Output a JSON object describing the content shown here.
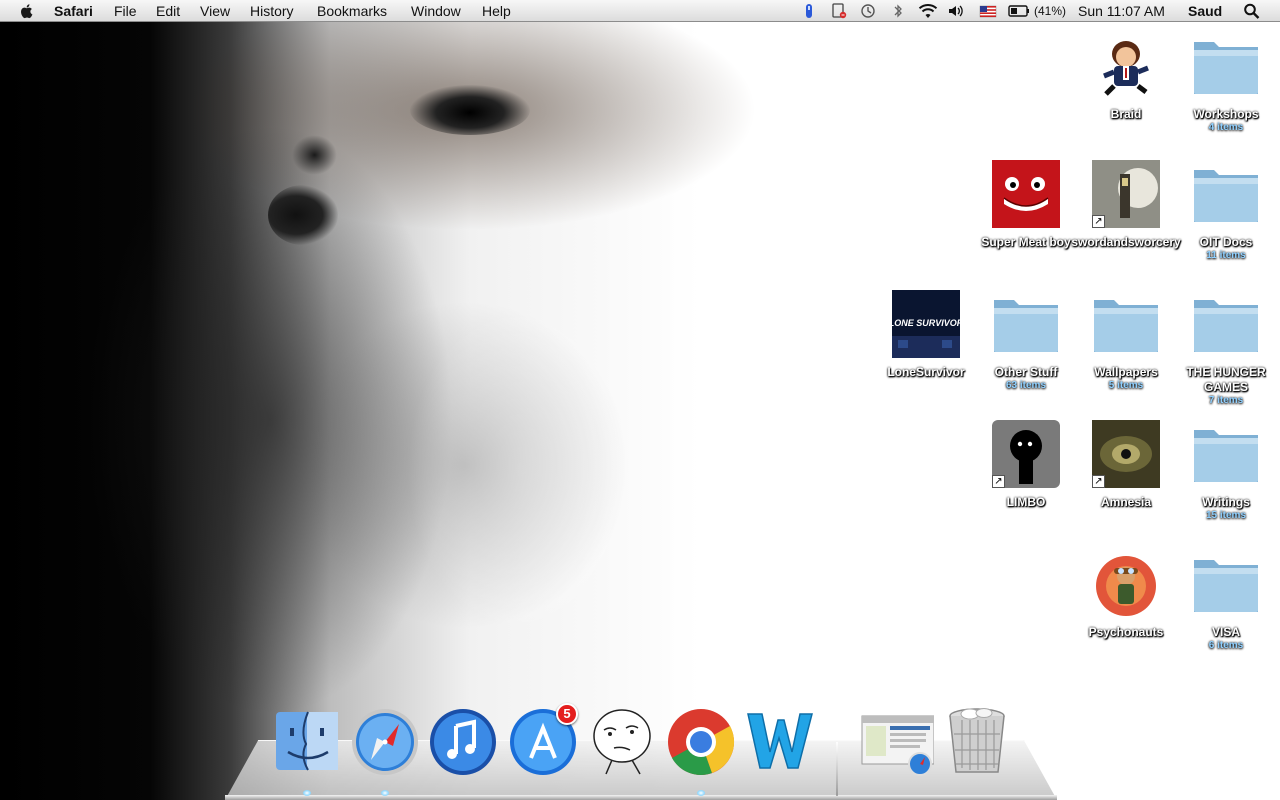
{
  "menubar": {
    "app_name": "Safari",
    "menus": [
      "File",
      "Edit",
      "View",
      "History",
      "Bookmarks",
      "Window",
      "Help"
    ],
    "battery_percent": "(41%)",
    "clock": "Sun 11:07 AM",
    "user": "Saud"
  },
  "desktop_icons": [
    {
      "label": "Braid",
      "sub": "",
      "kind": "game-art"
    },
    {
      "label": "Workshops",
      "sub": "4 items",
      "kind": "folder"
    },
    {
      "label": "Super Meat boy",
      "sub": "",
      "kind": "game-art"
    },
    {
      "label": "swordandsworcery",
      "sub": "",
      "kind": "game-art-alias"
    },
    {
      "label": "OIT Docs",
      "sub": "11 items",
      "kind": "folder"
    },
    {
      "label": "LoneSurvivor",
      "sub": "",
      "kind": "game-art",
      "art_text": "LONE SURVIVOR"
    },
    {
      "label": "Other Stuff",
      "sub": "63 items",
      "kind": "folder"
    },
    {
      "label": "Wallpapers",
      "sub": "5 items",
      "kind": "folder"
    },
    {
      "label": "THE HUNGER GAMES",
      "sub": "7 items",
      "kind": "folder"
    },
    {
      "label": "LIMBO",
      "sub": "",
      "kind": "game-art-alias"
    },
    {
      "label": "Amnesia",
      "sub": "",
      "kind": "game-art-alias"
    },
    {
      "label": "Writings",
      "sub": "15 items",
      "kind": "folder"
    },
    {
      "label": "Psychonauts",
      "sub": "",
      "kind": "game-art"
    },
    {
      "label": "VISA",
      "sub": "6 items",
      "kind": "folder"
    }
  ],
  "dock": {
    "items": [
      "finder-icon",
      "safari-icon",
      "itunes-icon",
      "app-store-icon",
      "meme-face-icon",
      "chrome-icon",
      "word-w-icon",
      "safari-window-thumbnail",
      "trash-icon"
    ],
    "app_store_badge": "5"
  },
  "colors": {
    "folder_blue": "#9ac6e3",
    "label_sub_blue": "#8fd0ff",
    "badge_red": "#e41e1e"
  }
}
